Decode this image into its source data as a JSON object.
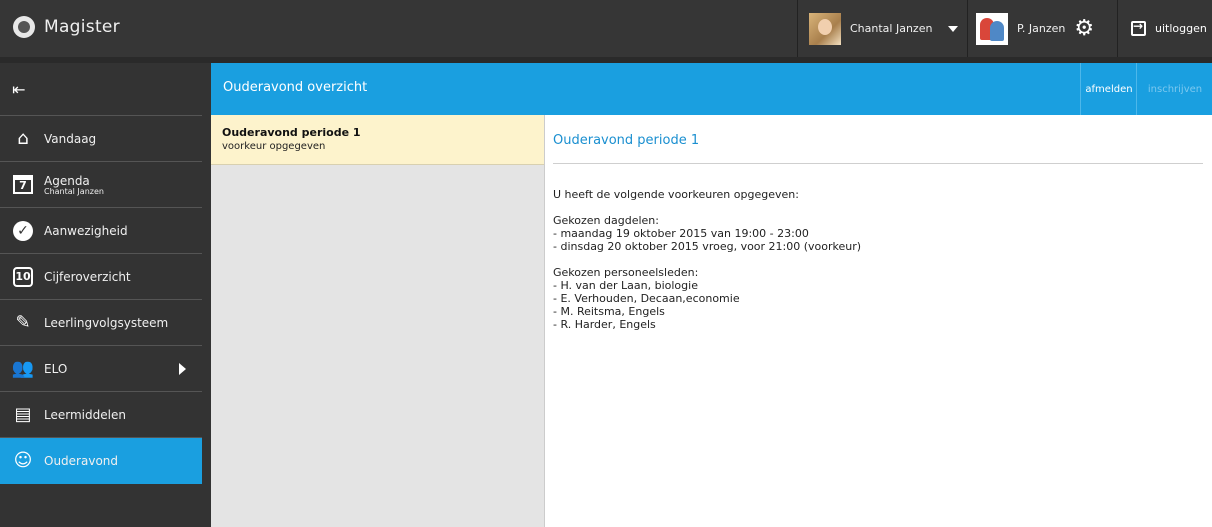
{
  "app": {
    "name": "Magister"
  },
  "topbar": {
    "user_name": "Chantal Janzen",
    "parent_name": "P. Janzen",
    "logout_label": "uitloggen"
  },
  "sidebar": {
    "items": [
      {
        "label": "Vandaag",
        "icon": "home-icon"
      },
      {
        "label": "Agenda",
        "sublabel": "Chantal Janzen",
        "icon": "calendar-icon",
        "icon_text": "7"
      },
      {
        "label": "Aanwezigheid",
        "icon": "checkmark-icon"
      },
      {
        "label": "Cijferoverzicht",
        "icon": "grades-icon",
        "icon_text": "10"
      },
      {
        "label": "Leerlingvolgsysteem",
        "icon": "notebook-icon"
      },
      {
        "label": "ELO",
        "icon": "group-icon"
      },
      {
        "label": "Leermiddelen",
        "icon": "books-icon"
      },
      {
        "label": "Ouderavond",
        "icon": "parent-meeting-icon"
      }
    ]
  },
  "main": {
    "title": "Ouderavond overzicht",
    "actions": {
      "afmelden": "afmelden",
      "inschrijven": "inschrijven"
    },
    "list": [
      {
        "title": "Ouderavond periode 1",
        "subtitle": "voorkeur opgegeven"
      }
    ],
    "detail": {
      "title": "Ouderavond periode 1",
      "intro": "U heeft de volgende voorkeuren opgegeven:",
      "dagdelen_heading": "Gekozen dagdelen:",
      "dagdelen": [
        "- maandag 19 oktober 2015 van 19:00 - 23:00",
        "- dinsdag 20 oktober 2015 vroeg, voor 21:00 (voorkeur)"
      ],
      "personeel_heading": "Gekozen personeelsleden:",
      "personeel": [
        "- H. van der Laan, biologie",
        "- E. Verhouden, Decaan,economie",
        "- M. Reitsma, Engels",
        "- R. Harder, Engels"
      ]
    }
  }
}
